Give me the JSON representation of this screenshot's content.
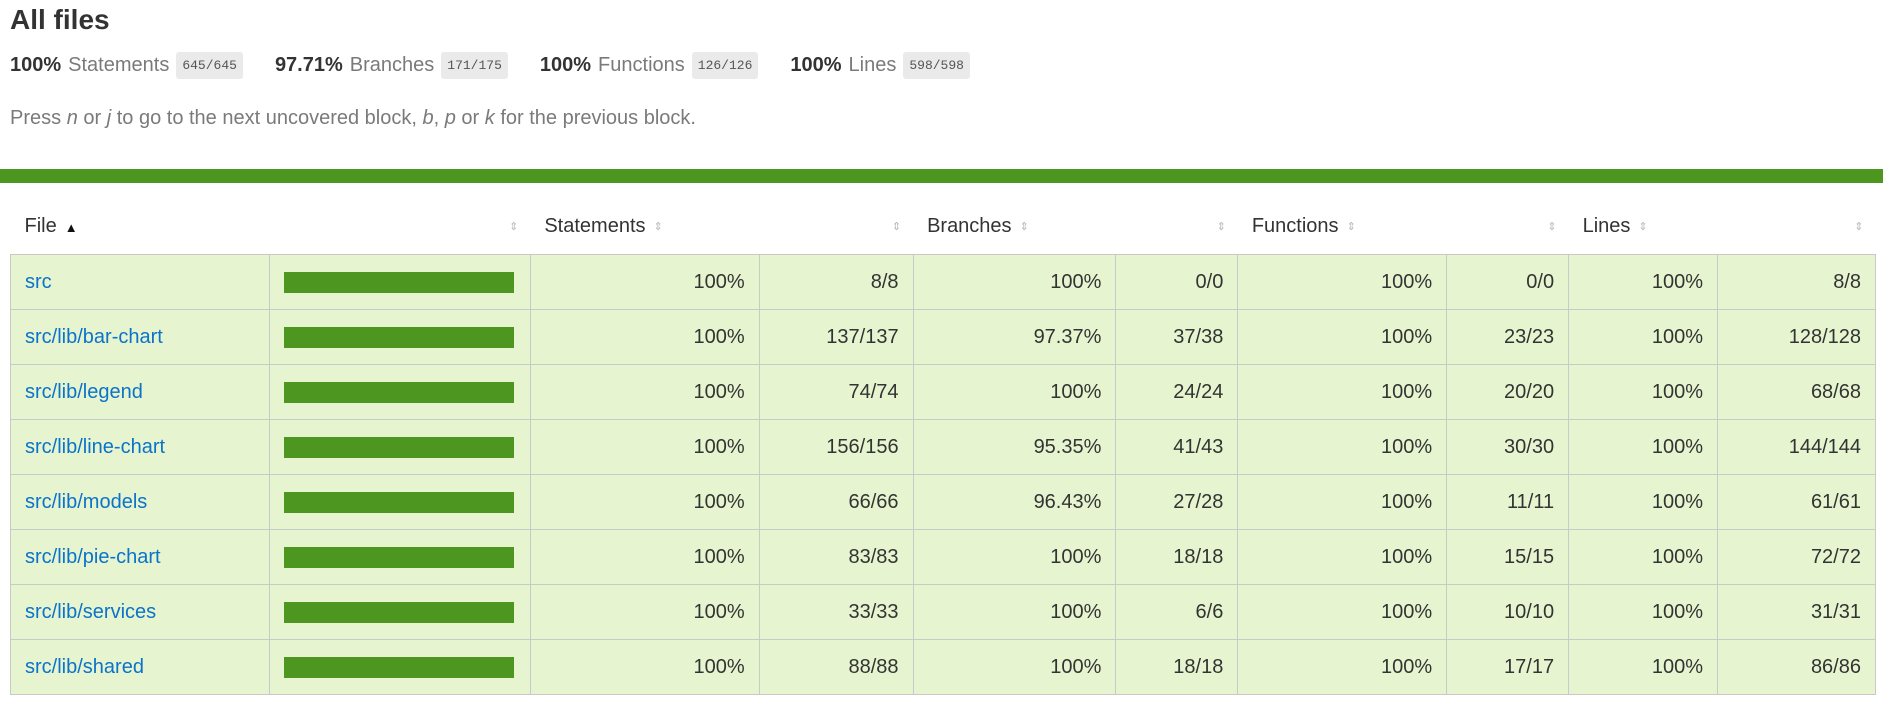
{
  "title": "All files",
  "summary": [
    {
      "pct": "100%",
      "label": "Statements",
      "fraction": "645/645"
    },
    {
      "pct": "97.71%",
      "label": "Branches",
      "fraction": "171/175"
    },
    {
      "pct": "100%",
      "label": "Functions",
      "fraction": "126/126"
    },
    {
      "pct": "100%",
      "label": "Lines",
      "fraction": "598/598"
    }
  ],
  "hint": {
    "p1": "Press ",
    "k1": "n",
    "p2": " or ",
    "k2": "j",
    "p3": " to go to the next uncovered block, ",
    "k3": "b",
    "p4": ", ",
    "k4": "p",
    "p5": " or ",
    "k5": "k",
    "p6": " for the previous block."
  },
  "status_color": "#4d961f",
  "headers": {
    "file": "File",
    "statements": "Statements",
    "branches": "Branches",
    "functions": "Functions",
    "lines": "Lines",
    "sort_asc_icon": "▲",
    "sortable_icon": "⇕"
  },
  "rows": [
    {
      "file": "src",
      "coverage": 1.0,
      "stmt_pct": "100%",
      "stmt": "8/8",
      "br_pct": "100%",
      "br": "0/0",
      "fn_pct": "100%",
      "fn": "0/0",
      "ln_pct": "100%",
      "ln": "8/8"
    },
    {
      "file": "src/lib/bar-chart",
      "coverage": 1.0,
      "stmt_pct": "100%",
      "stmt": "137/137",
      "br_pct": "97.37%",
      "br": "37/38",
      "fn_pct": "100%",
      "fn": "23/23",
      "ln_pct": "100%",
      "ln": "128/128"
    },
    {
      "file": "src/lib/legend",
      "coverage": 1.0,
      "stmt_pct": "100%",
      "stmt": "74/74",
      "br_pct": "100%",
      "br": "24/24",
      "fn_pct": "100%",
      "fn": "20/20",
      "ln_pct": "100%",
      "ln": "68/68"
    },
    {
      "file": "src/lib/line-chart",
      "coverage": 1.0,
      "stmt_pct": "100%",
      "stmt": "156/156",
      "br_pct": "95.35%",
      "br": "41/43",
      "fn_pct": "100%",
      "fn": "30/30",
      "ln_pct": "100%",
      "ln": "144/144"
    },
    {
      "file": "src/lib/models",
      "coverage": 1.0,
      "stmt_pct": "100%",
      "stmt": "66/66",
      "br_pct": "96.43%",
      "br": "27/28",
      "fn_pct": "100%",
      "fn": "11/11",
      "ln_pct": "100%",
      "ln": "61/61"
    },
    {
      "file": "src/lib/pie-chart",
      "coverage": 1.0,
      "stmt_pct": "100%",
      "stmt": "83/83",
      "br_pct": "100%",
      "br": "18/18",
      "fn_pct": "100%",
      "fn": "15/15",
      "ln_pct": "100%",
      "ln": "72/72"
    },
    {
      "file": "src/lib/services",
      "coverage": 1.0,
      "stmt_pct": "100%",
      "stmt": "33/33",
      "br_pct": "100%",
      "br": "6/6",
      "fn_pct": "100%",
      "fn": "10/10",
      "ln_pct": "100%",
      "ln": "31/31"
    },
    {
      "file": "src/lib/shared",
      "coverage": 1.0,
      "stmt_pct": "100%",
      "stmt": "88/88",
      "br_pct": "100%",
      "br": "18/18",
      "fn_pct": "100%",
      "fn": "17/17",
      "ln_pct": "100%",
      "ln": "86/86"
    }
  ]
}
